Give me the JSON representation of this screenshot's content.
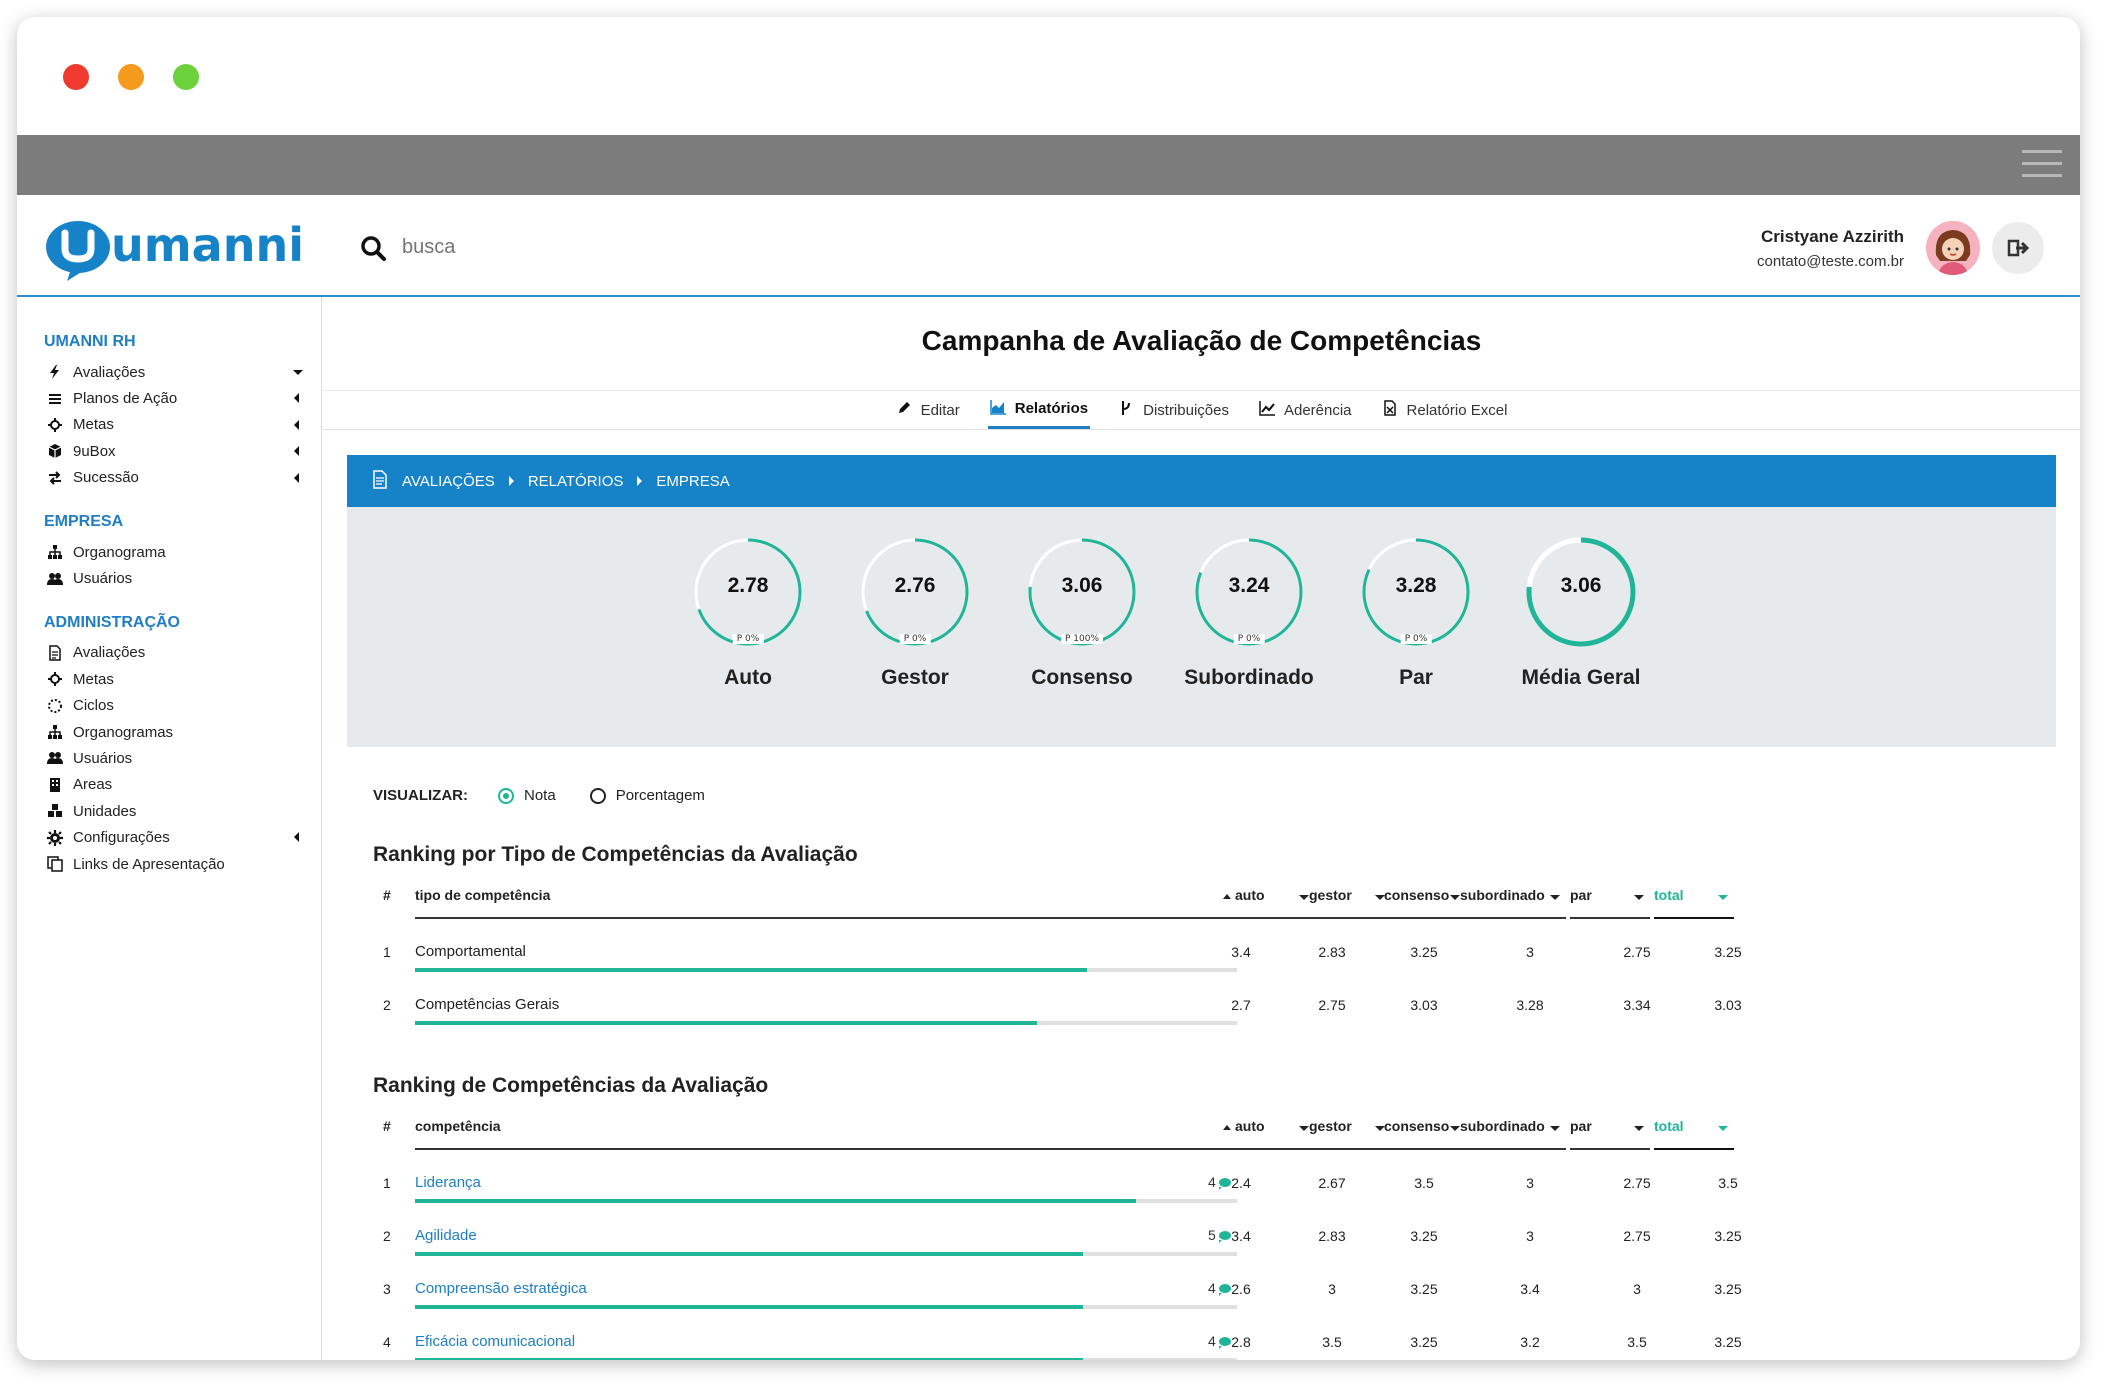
{
  "app": {
    "brand": "umanni",
    "search_placeholder": "busca",
    "user": {
      "name": "Cristyane Azzirith",
      "email": "contato@teste.com.br"
    }
  },
  "sidebar": {
    "sections": [
      {
        "title": "UMANNI RH",
        "items": [
          {
            "label": "Avaliações",
            "icon": "bolt-icon",
            "caret": "down"
          },
          {
            "label": "Planos de Ação",
            "icon": "list-icon",
            "caret": "left"
          },
          {
            "label": "Metas",
            "icon": "crosshair-icon",
            "caret": "left"
          },
          {
            "label": "9uBox",
            "icon": "cube-icon",
            "caret": "left"
          },
          {
            "label": "Sucessão",
            "icon": "exchange-icon",
            "caret": "left"
          }
        ]
      },
      {
        "title": "EMPRESA",
        "items": [
          {
            "label": "Organograma",
            "icon": "sitemap-icon"
          },
          {
            "label": "Usuários",
            "icon": "users-icon"
          }
        ]
      },
      {
        "title": "ADMINISTRAÇÃO",
        "items": [
          {
            "label": "Avaliações",
            "icon": "file-icon"
          },
          {
            "label": "Metas",
            "icon": "crosshair-icon"
          },
          {
            "label": "Ciclos",
            "icon": "circle-dashed-icon"
          },
          {
            "label": "Organogramas",
            "icon": "sitemap-icon"
          },
          {
            "label": "Usuários",
            "icon": "users-icon"
          },
          {
            "label": "Areas",
            "icon": "building-icon"
          },
          {
            "label": "Unidades",
            "icon": "cubes-icon"
          },
          {
            "label": "Configurações",
            "icon": "gear-icon",
            "caret": "left"
          },
          {
            "label": "Links de Apresentação",
            "icon": "copy-icon"
          }
        ]
      }
    ]
  },
  "page": {
    "title": "Campanha de Avaliação de Competências",
    "tabs": [
      {
        "label": "Editar",
        "icon": "pencil-icon",
        "active": false
      },
      {
        "label": "Relatórios",
        "icon": "area-chart-icon",
        "active": true
      },
      {
        "label": "Distribuições",
        "icon": "branch-icon",
        "active": false
      },
      {
        "label": "Aderência",
        "icon": "line-chart-icon",
        "active": false
      },
      {
        "label": "Relatório Excel",
        "icon": "excel-icon",
        "active": false
      }
    ],
    "breadcrumb": [
      "AVALIAÇÕES",
      "RELATÓRIOS",
      "EMPRESA"
    ]
  },
  "gauges": [
    {
      "value": "2.78",
      "pct": "P 0%",
      "label": "Auto",
      "fill": 0.695
    },
    {
      "value": "2.76",
      "pct": "P 0%",
      "label": "Gestor",
      "fill": 0.69
    },
    {
      "value": "3.06",
      "pct": "P 100%",
      "label": "Consenso",
      "fill": 0.765
    },
    {
      "value": "3.24",
      "pct": "P 0%",
      "label": "Subordinado",
      "fill": 0.81
    },
    {
      "value": "3.28",
      "pct": "P 0%",
      "label": "Par",
      "fill": 0.82
    },
    {
      "value": "3.06",
      "pct": "",
      "label": "Média Geral",
      "fill": 0.765
    }
  ],
  "visualizar": {
    "label": "VISUALIZAR:",
    "options": [
      "Nota",
      "Porcentagem"
    ],
    "selected": "Nota"
  },
  "ranking_tipo": {
    "title": "Ranking por Tipo de Competências da Avaliação",
    "headers": {
      "hash": "#",
      "name": "tipo de competência",
      "cols": [
        "auto",
        "gestor",
        "consenso",
        "subordinado",
        "par",
        "total"
      ]
    },
    "rows": [
      {
        "n": "1",
        "name": "Comportamental",
        "fill": 0.817,
        "vals": [
          "3.4",
          "2.83",
          "3.25",
          "3",
          "2.75",
          "3.25"
        ]
      },
      {
        "n": "2",
        "name": "Competências Gerais",
        "fill": 0.757,
        "vals": [
          "2.7",
          "2.75",
          "3.03",
          "3.28",
          "3.34",
          "3.03"
        ]
      }
    ]
  },
  "ranking_comp": {
    "title": "Ranking de Competências da Avaliação",
    "headers": {
      "hash": "#",
      "name": "competência",
      "cols": [
        "auto",
        "gestor",
        "consenso",
        "subordinado",
        "par",
        "total"
      ]
    },
    "rows": [
      {
        "n": "1",
        "name": "Liderança",
        "count": "4",
        "fill": 0.877,
        "vals": [
          "2.4",
          "2.67",
          "3.5",
          "3",
          "2.75",
          "3.5"
        ]
      },
      {
        "n": "2",
        "name": "Agilidade",
        "count": "5",
        "fill": 0.813,
        "vals": [
          "3.4",
          "2.83",
          "3.25",
          "3",
          "2.75",
          "3.25"
        ]
      },
      {
        "n": "3",
        "name": "Compreensão estratégica",
        "count": "4",
        "fill": 0.813,
        "vals": [
          "2.6",
          "3",
          "3.25",
          "3.4",
          "3",
          "3.25"
        ]
      },
      {
        "n": "4",
        "name": "Eficácia comunicacional",
        "count": "4",
        "fill": 0.813,
        "vals": [
          "2.8",
          "3.5",
          "3.25",
          "3.2",
          "3.5",
          "3.25"
        ]
      }
    ]
  },
  "colors": {
    "accent": "#1683c9",
    "teal": "#1fb596",
    "link": "#1f7ec4"
  }
}
